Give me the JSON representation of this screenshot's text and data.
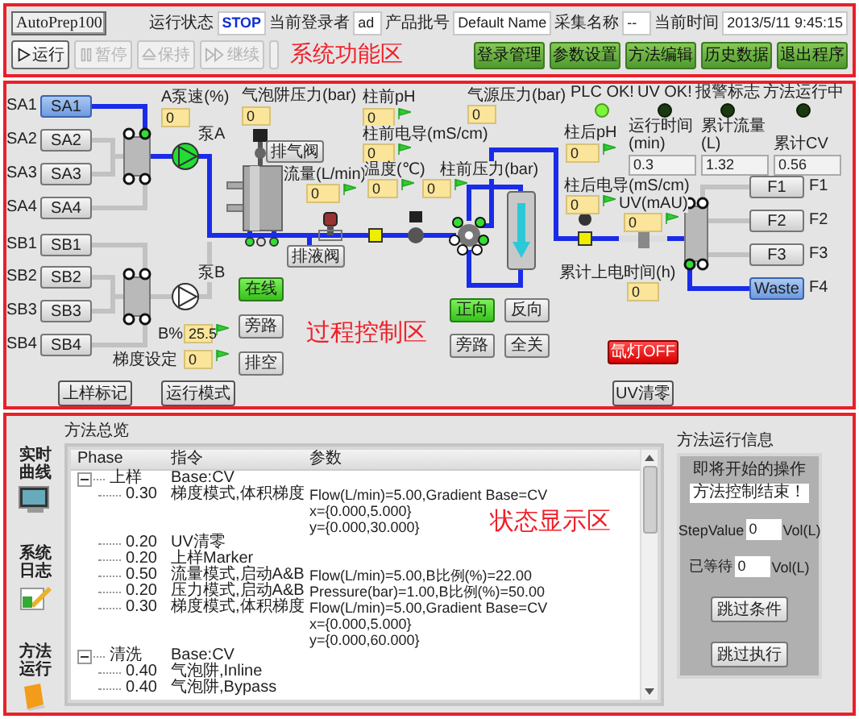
{
  "header": {
    "logo": "AutoPrep100",
    "fields": [
      {
        "label": "运行状态",
        "value": "STOP",
        "kind": "status"
      },
      {
        "label": "当前登录者",
        "value": "ad",
        "kind": "text"
      },
      {
        "label": "产品批号",
        "value": "Default Name",
        "kind": "text"
      },
      {
        "label": "采集名称",
        "value": "--",
        "kind": "text"
      },
      {
        "label": "当前时间",
        "value": "2013/5/11 9:45:15",
        "kind": "text"
      }
    ],
    "control_buttons": [
      {
        "label": "运行",
        "disabled": false
      },
      {
        "label": "暂停",
        "disabled": true
      },
      {
        "label": "保持",
        "disabled": true
      },
      {
        "label": "继续",
        "disabled": true
      },
      {
        "disabled": true
      }
    ],
    "annotation": "系统功能区",
    "menu_buttons": [
      "登录管理",
      "参数设置",
      "方法编辑",
      "历史数据",
      "退出程序"
    ]
  },
  "process": {
    "sources": [
      {
        "label": "SA1",
        "button": "SA1",
        "selected": true
      },
      {
        "label": "SA2",
        "button": "SA2",
        "selected": false
      },
      {
        "label": "SA3",
        "button": "SA3",
        "selected": false
      },
      {
        "label": "SA4",
        "button": "SA4",
        "selected": false
      },
      {
        "label": "SB1",
        "button": "SB1",
        "selected": false
      },
      {
        "label": "SB2",
        "button": "SB2",
        "selected": false
      },
      {
        "label": "SB3",
        "button": "SB3",
        "selected": false
      },
      {
        "label": "SB4",
        "button": "SB4",
        "selected": false
      }
    ],
    "readouts": [
      {
        "label": "A泵速(%)",
        "value": "0"
      },
      {
        "label": "气泡阱压力(bar)",
        "value": "0"
      },
      {
        "label": "柱前pH",
        "value": "0"
      },
      {
        "label": "气源压力(bar)",
        "value": "0"
      },
      {
        "label": "柱前电导(mS/cm)",
        "value": "0"
      },
      {
        "label": "流量(L/min)",
        "value": "0"
      },
      {
        "label": "温度(℃)",
        "value": "0"
      },
      {
        "label": "柱前压力(bar)",
        "value": "0"
      },
      {
        "label": "柱后pH",
        "value": "0"
      },
      {
        "label": "柱后电导(mS/cm)",
        "value": "0"
      },
      {
        "label": "UV(mAU)",
        "value": "0"
      },
      {
        "label": "累计上电时间(h)",
        "value": "0"
      },
      {
        "label": "B%",
        "value": "25.5"
      },
      {
        "label": "梯度设定",
        "value": "0"
      }
    ],
    "pumps": [
      {
        "label": "泵A",
        "running": true
      },
      {
        "label": "泵B",
        "running": false
      }
    ],
    "valve_buttons": [
      "排气阀",
      "排液阀"
    ],
    "route_buttons": [
      {
        "label": "在线",
        "on": true
      },
      {
        "label": "旁路",
        "on": false
      },
      {
        "label": "排空",
        "on": false
      },
      {
        "label": "正向",
        "on": true
      },
      {
        "label": "反向",
        "on": false
      },
      {
        "label": "旁路",
        "on": false
      },
      {
        "label": "全关",
        "on": false
      }
    ],
    "indicators": [
      {
        "label": "PLC OK!",
        "on": true
      },
      {
        "label": "UV OK!",
        "on": false
      },
      {
        "label": "报警标志",
        "on": false
      },
      {
        "label": "方法运行中",
        "on": false
      }
    ],
    "totals": [
      {
        "label": "运行时间(min)",
        "value": "0.3"
      },
      {
        "label": "累计流量(L)",
        "value": "1.32"
      },
      {
        "label": "累计CV",
        "value": "0.56"
      }
    ],
    "outlets": [
      {
        "button": "F1",
        "label": "F1",
        "selected": false
      },
      {
        "button": "F2",
        "label": "F2",
        "selected": false
      },
      {
        "button": "F3",
        "label": "F3",
        "selected": false
      },
      {
        "button": "Waste",
        "label": "F4",
        "selected": true
      }
    ],
    "lamp_button": {
      "label": "氙灯OFF",
      "on": false
    },
    "buttons": [
      "上样标记",
      "运行模式",
      "UV清零"
    ],
    "annotation": "过程控制区"
  },
  "status": {
    "nav": [
      "实时曲线",
      "系统日志",
      "方法运行"
    ],
    "tree_title": "方法总览",
    "columns": [
      "Phase",
      "指令",
      "参数"
    ],
    "phases": [
      {
        "name": "上样",
        "command": "Base:CV",
        "expanded": true,
        "children": [
          {
            "phase": "0.30",
            "command": "梯度模式,体积梯度",
            "params": [
              "Flow(L/min)=5.00,Gradient Base=CV",
              "x={0.000,5.000}",
              "y={0.000,30.000}"
            ]
          },
          {
            "phase": "0.20",
            "command": "UV清零"
          },
          {
            "phase": "0.20",
            "command": "上样Marker"
          },
          {
            "phase": "0.50",
            "command": "流量模式,启动A&B",
            "params": [
              "Flow(L/min)=5.00,B比例(%)=22.00"
            ]
          },
          {
            "phase": "0.20",
            "command": "压力模式,启动A&B",
            "params": [
              "Pressure(bar)=1.00,B比例(%)=50.00"
            ]
          },
          {
            "phase": "0.30",
            "command": "梯度模式,体积梯度",
            "params": [
              "Flow(L/min)=5.00,Gradient Base=CV",
              "x={0.000,5.000}",
              "y={0.000,60.000}"
            ]
          }
        ]
      },
      {
        "name": "清洗",
        "command": "Base:CV",
        "expanded": true,
        "children": [
          {
            "phase": "0.40",
            "command": "气泡阱,Inline"
          },
          {
            "phase": "0.40",
            "command": "气泡阱,Bypass"
          }
        ]
      }
    ],
    "annotation": "状态显示区",
    "info": {
      "title": "方法运行信息",
      "next_label": "即将开始的操作",
      "next_value": "方法控制结束！",
      "fields": [
        {
          "label": "StepValue",
          "value": "0",
          "unit": "Vol(L)"
        },
        {
          "label": "已等待",
          "value": "0",
          "unit": "Vol(L)"
        }
      ],
      "buttons": [
        "跳过条件",
        "跳过执行"
      ]
    }
  }
}
